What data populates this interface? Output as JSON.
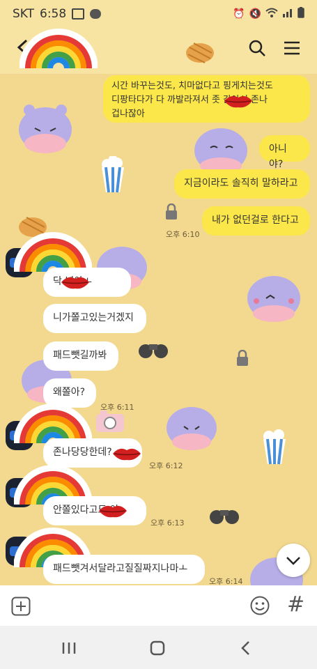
{
  "status": {
    "carrier": "SKT",
    "time": "6:58"
  },
  "messages_mine": [
    {
      "text": "시간 바꾸는것도, 치마없다고 핑게치는것도\n디팡타다가 다 까발라져서 좃   같아서 존나\n겁나잖아"
    },
    {
      "text": "아니야?"
    },
    {
      "text": "지금이라도 솔직히 말하라고"
    },
    {
      "text": "내가 없던걸로 한다고",
      "time": "오후 6:10"
    }
  ],
  "messages_theirs": [
    {
      "text": "닥         년아ㅗ"
    },
    {
      "text": "니가쫄고있는거겠지"
    },
    {
      "text": "패드뺏길까봐"
    },
    {
      "text": "왜쫄아?",
      "time": "오후 6:11"
    },
    {
      "text": "존나당당한데?",
      "time": "오후 6:12"
    },
    {
      "text": "안쫄있다고도         야",
      "time": "오후 6:13"
    },
    {
      "text": "패드뺏겨서달라고질질짜지나마ㅗ",
      "time": "오후 6:14"
    }
  ],
  "input": {
    "hash": "#"
  }
}
